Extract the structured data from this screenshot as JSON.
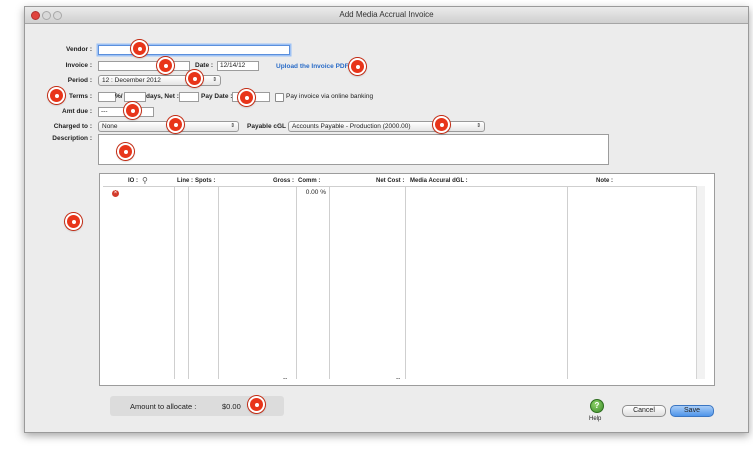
{
  "window": {
    "title": "Add Media Accrual Invoice"
  },
  "form": {
    "vendor_label": "Vendor :",
    "vendor_value": "",
    "invoice_label": "Invoice :",
    "invoice_value": "",
    "date_label": "Date :",
    "date_value": "12/14/12",
    "upload_link": "Upload the Invoice PDF",
    "period_label": "Period :",
    "period_value": "12 : December 2012",
    "terms_label": "Terms :",
    "terms_percent": "",
    "terms_pct_sep": "%/",
    "terms_days": "",
    "days_net_label": "days, Net :",
    "net_value": "",
    "pay_date_label": "Pay Date :",
    "pay_date_value": "",
    "online_banking_label": "Pay invoice via online banking",
    "online_banking_checked": false,
    "amt_due_label": "Amt due :",
    "amt_due_value": "---",
    "charged_to_label": "Charged to :",
    "charged_to_value": "None",
    "payable_label": "Payable cGL :",
    "payable_value": "Accounts Payable - Production (2000.00)",
    "description_label": "Description :",
    "description_value": ""
  },
  "grid": {
    "columns": {
      "io": "IO :",
      "line": "Line :",
      "spots": "Spots :",
      "gross": "Gross :",
      "comm": "Comm :",
      "net_cost": "Net Cost :",
      "media_accrual": "Media Accural dGL :",
      "note": "Note :"
    },
    "row": {
      "comm": "0.00 %"
    },
    "total_gross": "--",
    "total_net": "--"
  },
  "footer": {
    "allocate_label": "Amount to allocate :",
    "allocate_value": "$0.00",
    "help_label": "Help",
    "cancel_label": "Cancel",
    "save_label": "Save"
  },
  "colors": {
    "marker": "#e8351a",
    "link": "#2a6cc7",
    "save_button": "#4f95ea"
  }
}
